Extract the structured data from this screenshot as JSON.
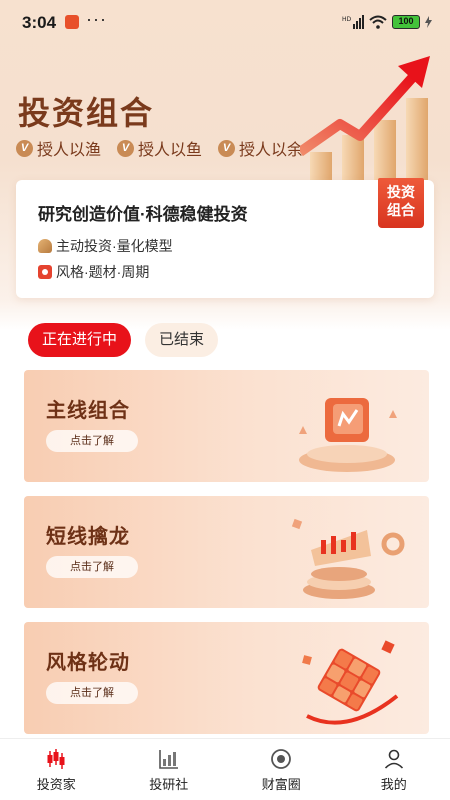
{
  "status_bar": {
    "time": "3:04",
    "app_badge": "东方财富",
    "dots": "···",
    "battery": "100"
  },
  "hero": {
    "title": "投资组合",
    "tags": [
      {
        "check": "V",
        "label": "授人以渔"
      },
      {
        "check": "V",
        "label": "授人以鱼"
      },
      {
        "check": "V",
        "label": "授人以余"
      }
    ]
  },
  "intro": {
    "title": "研究创造价值·科德稳健投资",
    "line1": "主动投资·量化模型",
    "line2": "风格·题材·周期",
    "ribbon_line1": "投资",
    "ribbon_line2": "组合"
  },
  "tabs": [
    {
      "label": "正在进行中",
      "active": true
    },
    {
      "label": "已结束",
      "active": false
    }
  ],
  "combos": [
    {
      "name": "主线组合",
      "button": "点击了解"
    },
    {
      "name": "短线擒龙",
      "button": "点击了解"
    },
    {
      "name": "风格轮动",
      "button": "点击了解"
    }
  ],
  "bottom_nav": [
    {
      "label": "投资家",
      "icon": "candlestick-icon",
      "active": true
    },
    {
      "label": "投研社",
      "icon": "bar-chart-icon",
      "active": false
    },
    {
      "label": "财富圈",
      "icon": "circle-icon",
      "active": false
    },
    {
      "label": "我的",
      "icon": "user-icon",
      "active": false
    }
  ],
  "colors": {
    "accent_red": "#e8121a",
    "title_brown": "#7a3a1c"
  }
}
